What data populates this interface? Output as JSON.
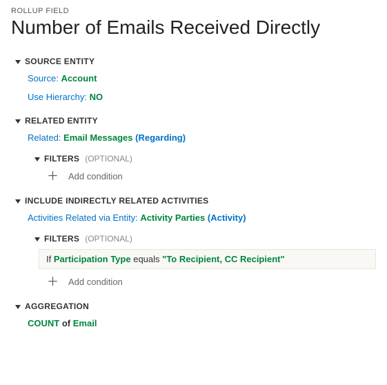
{
  "eyebrow": "ROLLUP FIELD",
  "title": "Number of Emails Received Directly",
  "sections": {
    "source": {
      "label": "SOURCE ENTITY",
      "source_label": "Source:",
      "source_value": "Account",
      "hierarchy_label": "Use Hierarchy:",
      "hierarchy_value": "NO"
    },
    "related": {
      "label": "RELATED ENTITY",
      "related_label": "Related:",
      "related_value": "Email Messages",
      "related_paren": "Regarding",
      "filters_label": "FILTERS",
      "filters_optional": "(OPTIONAL)",
      "add_condition": "Add condition"
    },
    "indirect": {
      "label": "INCLUDE INDIRECTLY RELATED ACTIVITIES",
      "arve_label": "Activities Related via Entity:",
      "arve_value": "Activity Parties",
      "arve_paren": "Activity",
      "filters_label": "FILTERS",
      "filters_optional": "(OPTIONAL)",
      "condition": {
        "if": "If",
        "field": "Participation Type",
        "op": "equals",
        "value": "\"To Recipient, CC Recipient\""
      },
      "add_condition": "Add condition"
    },
    "aggregation": {
      "label": "AGGREGATION",
      "func": "COUNT",
      "of": "of",
      "entity": "Email"
    }
  }
}
